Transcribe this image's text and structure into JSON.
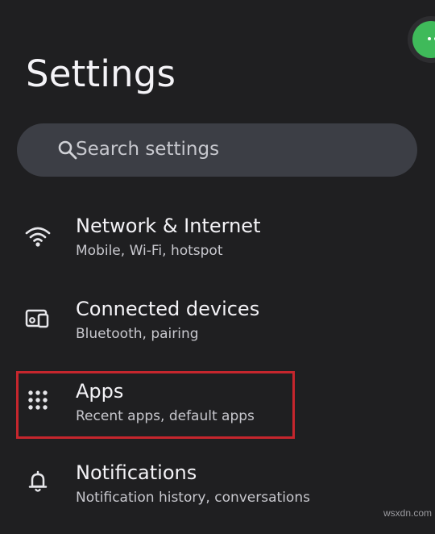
{
  "header": {
    "title": "Settings"
  },
  "search": {
    "placeholder": "Search settings",
    "icon": "search-icon"
  },
  "items": [
    {
      "title": "Network & Internet",
      "subtitle": "Mobile, Wi-Fi, hotspot",
      "icon": "wifi-icon"
    },
    {
      "title": "Connected devices",
      "subtitle": "Bluetooth, pairing",
      "icon": "connected-devices-icon"
    },
    {
      "title": "Apps",
      "subtitle": "Recent apps, default apps",
      "icon": "apps-grid-icon",
      "highlighted": true
    },
    {
      "title": "Notifications",
      "subtitle": "Notification history, conversations",
      "icon": "bell-icon"
    }
  ],
  "colors": {
    "background": "#1f1f21",
    "search_background": "#3c3e45",
    "highlight": "#c5262d",
    "fab": "#3fba5a"
  },
  "watermark": "wsxdn.com"
}
